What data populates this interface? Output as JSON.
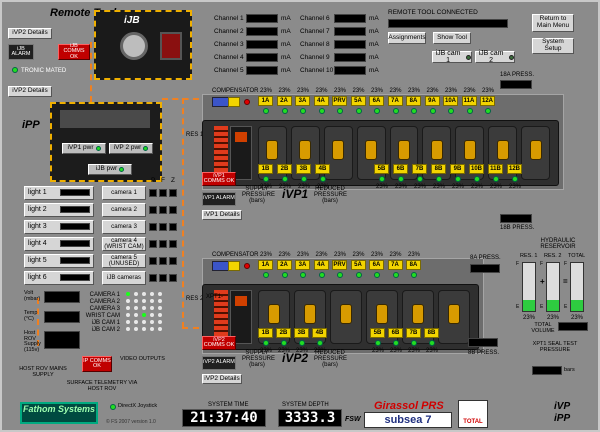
{
  "header": {
    "title": "Remote Tool",
    "conn_label": "REMOTE TOOL CONNECTED"
  },
  "ijb": {
    "title": "iJB",
    "alarm": "iJB ALARM",
    "comm": "iJB COMMS OK",
    "details": "iVP2 Details",
    "tronic": "TRONIC MATED"
  },
  "channels": {
    "left": [
      {
        "label": "Channel 1",
        "unit": "mA"
      },
      {
        "label": "Channel 2",
        "unit": "mA"
      },
      {
        "label": "Channel 3",
        "unit": "mA"
      },
      {
        "label": "Channel 4",
        "unit": "mA"
      },
      {
        "label": "Channel 5",
        "unit": "mA"
      }
    ],
    "right": [
      {
        "label": "Channel 6",
        "unit": "mA"
      },
      {
        "label": "Channel 7",
        "unit": "mA"
      },
      {
        "label": "Channel 8",
        "unit": "mA"
      },
      {
        "label": "Channel 9",
        "unit": "mA"
      },
      {
        "label": "Channel 10",
        "unit": "mA"
      }
    ]
  },
  "buttons": {
    "assignments": "Assignments",
    "show_tool": "Show Tool",
    "cam1": "iJB cam 1",
    "cam2": "iJB cam 2",
    "return_menu": "Return to Main Menu",
    "system_setup": "System Setup"
  },
  "ipp": {
    "details": "iVP2 Details",
    "title": "iPP",
    "vp1_pwr": "iVP1 pwr",
    "vp2_pwr": "iVP 2 pwr",
    "jb_pwr": "iJB pwr"
  },
  "lights": [
    "light 1",
    "light 2",
    "light 3",
    "light 4",
    "light 5",
    "light 6"
  ],
  "cameras": [
    "camera 1",
    "camera 2",
    "camera 3",
    "camera 4 (WRIST CAM)",
    "camera 5 (UNUSED)",
    "iJB cameras"
  ],
  "pfz": [
    "P",
    "F",
    "Z"
  ],
  "meters": [
    {
      "label": "Volt (mbar)"
    },
    {
      "label": "Temp (°C)"
    },
    {
      "label": "Host ROV Supply (115v)"
    }
  ],
  "matrix": {
    "rows": [
      "CAMERA 1",
      "CAMERA 2",
      "CAMERA 3",
      "WRIST CAM",
      "iJB CAM 1",
      "iJB CAM 2"
    ],
    "video_outputs": "VIDEO OUTPUTS",
    "comm": "IP COMMS OK"
  },
  "bottom_labels": {
    "host_rov": "HOST ROV MAINS SUPPLY",
    "surface": "SURFACE TELEMETRY VIA HOST ROV",
    "directx": "DirectX Joystick",
    "version": "© FS 2007 version 1.0"
  },
  "brand": {
    "name": "Fathom Systems",
    "girassol": "Girassol PRS",
    "subsea": "subsea 7",
    "total": "TOTAL"
  },
  "system_time": {
    "label": "SYSTEM TIME",
    "value": "21:37:40"
  },
  "system_depth": {
    "label": "SYSTEM DEPTH",
    "value": "3333.3",
    "unit": "FSW"
  },
  "ivp1": {
    "compensator": "COMPENSATOR",
    "res": "RES 1-",
    "press18a": "18A PRESS.",
    "press18b": "18B PRESS.",
    "supply": "SUPPLY PRESSURE (bars)",
    "reduced": "REDUCED PRESSURE (bars)",
    "comm": "iVP1 COMMS OK",
    "alarm": "iVP1 ALARM",
    "details": "iVP1 Details",
    "title": "iVP1",
    "top_tags": [
      "1A",
      "2A",
      "3A",
      "4A",
      "PRV",
      "5A",
      "6A",
      "7A",
      "8A",
      "9A",
      "10A",
      "11A",
      "12A"
    ],
    "bottom_tags": [
      "1B",
      "2B",
      "3B",
      "4B",
      "5B",
      "6B",
      "7B",
      "8B",
      "9B",
      "10B",
      "11B",
      "12B"
    ],
    "pct": "23%"
  },
  "ivp2": {
    "compensator": "COMPENSATOR",
    "res": "RES 2-",
    "xpt": "XPT1-",
    "press8a": "8A PRESS.",
    "press8b": "8B PRESS.",
    "supply": "SUPPLY PRESSURE (bars)",
    "reduced": "REDUCED PRESSURE (bars)",
    "comm": "iVP2 COMMS OK",
    "alarm": "iVP2 ALARM",
    "details": "iVP2 Details",
    "title": "iVP2",
    "top_tags": [
      "1A",
      "2A",
      "3A",
      "4A",
      "PRV",
      "5A",
      "6A",
      "7A",
      "8A"
    ],
    "bottom_tags": [
      "1B",
      "2B",
      "3B",
      "4B",
      "5B",
      "6B",
      "7B",
      "8B"
    ],
    "pct": "23%"
  },
  "reservoir": {
    "title": "HYDRAULIC RESERVOIR",
    "r1": "RES. 1",
    "r2": "RES. 2",
    "total": "TOTAL",
    "f": "F",
    "e": "E",
    "pct": "23%",
    "total_volume": "TOTAL VOLUME",
    "xpt": "XPT1 SEAL TEST PRESSURE",
    "unit": "bars"
  },
  "footer_title": {
    "line1": "iVP",
    "line2": "iPP"
  }
}
